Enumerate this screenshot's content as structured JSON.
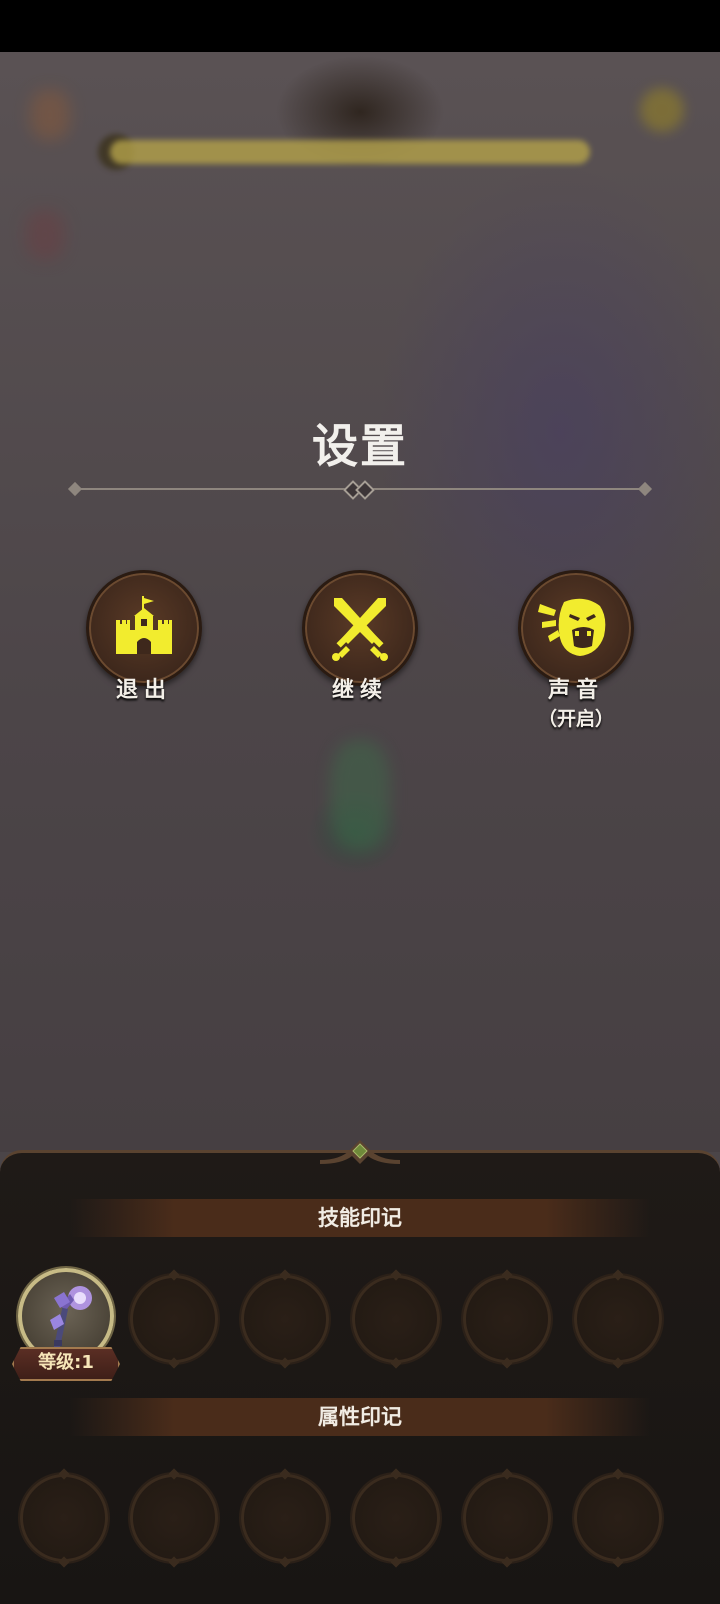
{
  "settings": {
    "title": "设置",
    "options": [
      {
        "id": "exit",
        "label": "退出",
        "icon": "castle-icon"
      },
      {
        "id": "continue",
        "label": "继续",
        "icon": "crossed-swords-icon"
      },
      {
        "id": "sound",
        "label": "声音",
        "sublabel": "（开启）",
        "icon": "shouting-face-icon"
      }
    ]
  },
  "panel": {
    "skill_section": {
      "title": "技能印记",
      "equipped": {
        "icon": "magic-staff-icon",
        "level_label": "等级:1"
      }
    },
    "attribute_section": {
      "title": "属性印记"
    }
  },
  "colors": {
    "icon_yellow": "#f2ec2e",
    "medal_brown": "#3e281c",
    "panel_bg": "#1f1a17",
    "section_bar": "#4a2c1a"
  }
}
